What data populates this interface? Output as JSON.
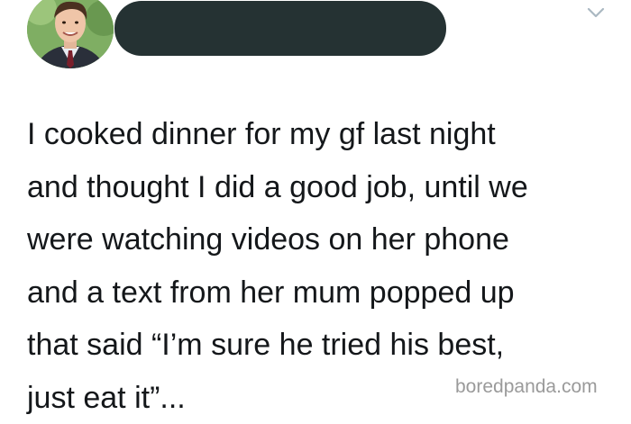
{
  "tweet": {
    "text_lines": [
      "I cooked dinner for my gf last night",
      "and thought I did a good job, until we",
      "were watching videos on her phone",
      "and a text from her mum popped up",
      "that said “I’m sure he tried his best,",
      "just eat it”..."
    ],
    "author_avatar_icon": "profile-photo-icon",
    "menu_icon": "chevron-down-icon"
  },
  "watermark": {
    "text": "boredpanda.com"
  },
  "colors": {
    "text": "#14171a",
    "redaction": "#253233",
    "watermark": "#9a9a9a",
    "chevron": "#aab8c2"
  }
}
